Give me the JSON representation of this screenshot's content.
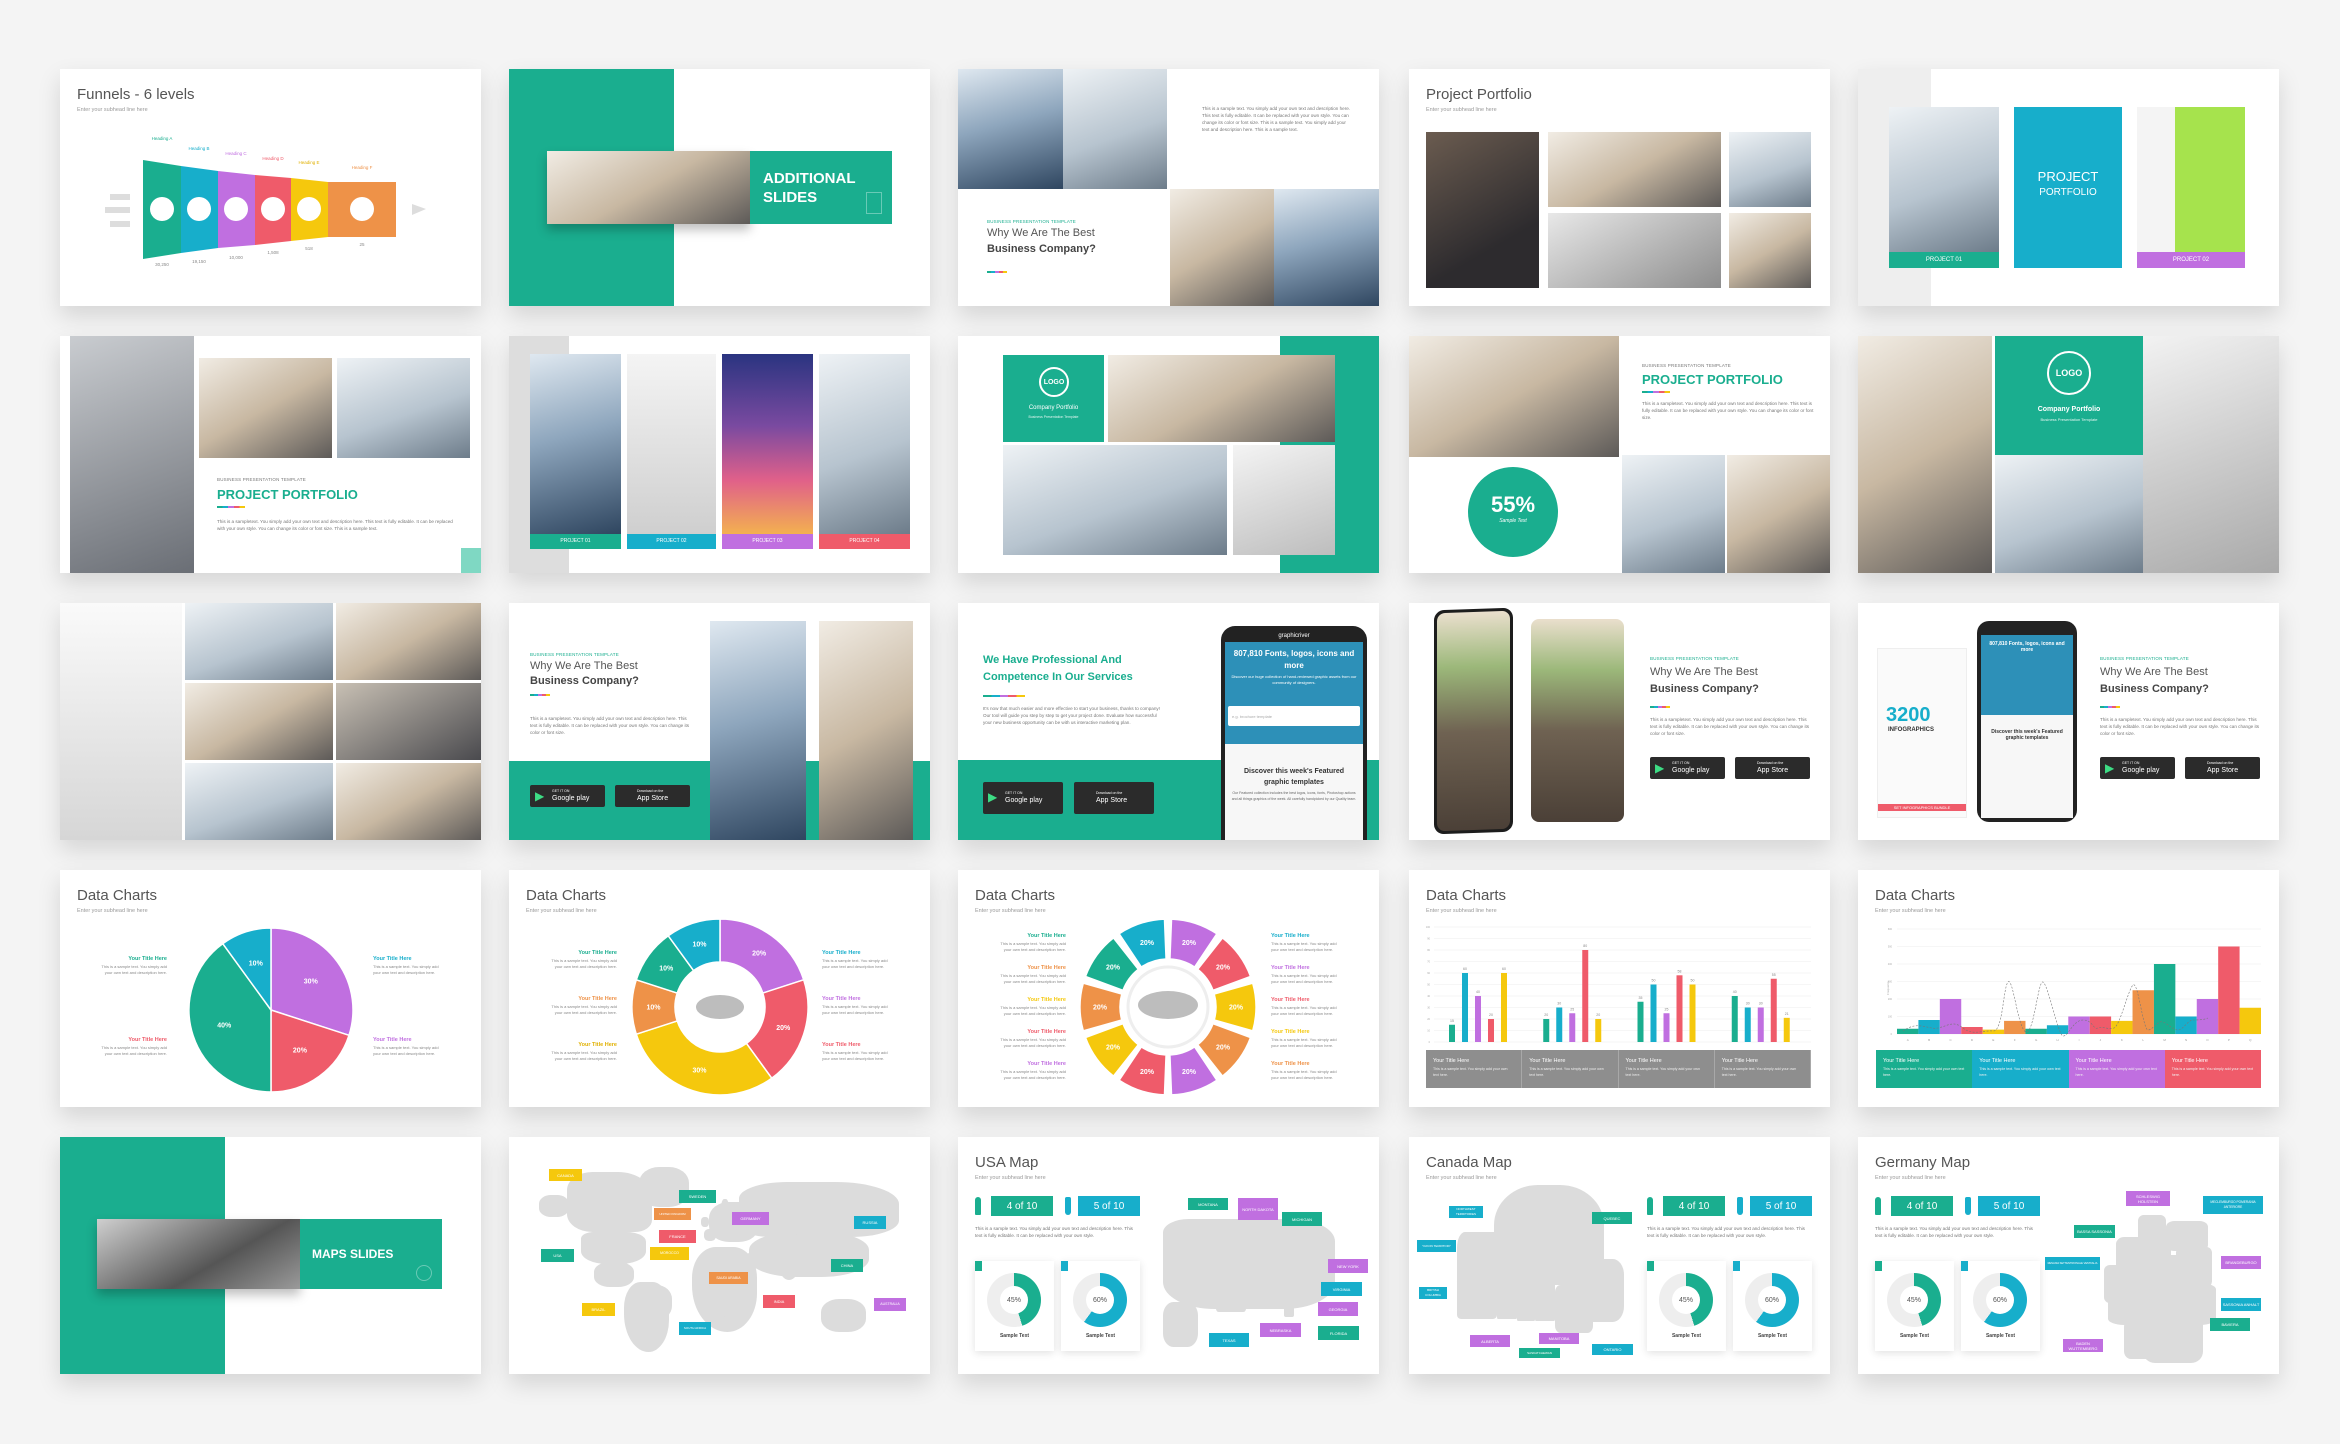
{
  "colors": {
    "green": "#1aae8f",
    "teal": "#17aecb",
    "purple": "#c06fe0",
    "red": "#ef5b6a",
    "yellow": "#f5c80d",
    "orange": "#ee9248",
    "gray": "#8e8e8e"
  },
  "common": {
    "subhead": "Enter your subhead line here",
    "your_title": "Your Title Here",
    "short_body": "This is a sample text. You simply add your own text and description here.",
    "bar_body": "This is a sample text. You simply add your own text here.",
    "template_label": "BUSINESS PRESENTATION TEMPLATE",
    "why_title_1": "Why We Are The Best",
    "why_title_2": "Business Company?",
    "why_body": "This is a sampletext. You simply add your own text and description here. This text is fully editable. It can be replaced with your own style. You can change its color or font size.",
    "portfolio_body": "This is a sampletext. You simply add your own text and description here. This text is fully editable. It can be replaced with your own style. You can change its color or font size. This is a sample text.",
    "map_body": "This is a sample text. You simply add your own text and description here. This text is fully editable. It can be replaced with your own style.",
    "sample_text": "Sample Text",
    "stat_male": "4 of 10",
    "stat_female": "5 of 10",
    "donut_labels": [
      "45%",
      "60%"
    ],
    "donut_values": [
      45,
      60
    ],
    "google_small": "GET IT ON",
    "google": "Google play",
    "apple_small": "Download on the",
    "apple": "App Store",
    "data_charts": "Data Charts"
  },
  "funnel": {
    "title": "Funnels - 6 levels",
    "headings": [
      "Heading A",
      "Heading B",
      "Heading C",
      "Heading D",
      "Heading E",
      "Heading F"
    ],
    "values": [
      "30,250",
      "19,150",
      "10,000",
      "1,508",
      "518",
      "25"
    ],
    "icons": [
      "search-icon",
      "chart-screen-icon",
      "monitor-icon",
      "bar-chart-icon",
      "handshake-icon",
      "target-icon"
    ]
  },
  "additional": {
    "line1": "ADDITIONAL",
    "line2": "SLIDES"
  },
  "why_intro": {
    "body": "This is a sample text. You simply add your own text and description here. This text is fully editable. It can be replaced with your own style. You can change its color or font size. This is a sample text. You simply add your text and description here. This is a sample text."
  },
  "portfolio_grid": {
    "title": "Project Portfolio"
  },
  "portfolio_cover": {
    "line1": "PROJECT",
    "line2": "PORTFOLIO",
    "project1": "PROJECT 01",
    "project2": "PROJECT 02"
  },
  "portfolio_text": {
    "title": "PROJECT PORTFOLIO"
  },
  "projects": [
    "PROJECT 01",
    "PROJECT 02",
    "PROJECT 03",
    "PROJECT 04"
  ],
  "logo": {
    "logo": "LOGO",
    "name": "Company Portfolio",
    "sub": "Business Presentation Template"
  },
  "percent": {
    "value": "55%",
    "caption": "Sample Text"
  },
  "services": {
    "title1": "We Have Professional And",
    "title2": "Competence In Our Services",
    "body": "It's now that much easier and more effective to start your business, thanks to company! Our tool will guide you step by step to get your project done. Evaluate how successful your new business opportunity can be with us interactive marketing plan."
  },
  "phone": {
    "brand": "graphicriver",
    "headline": "807,810 Fonts, logos, icons and more",
    "sub": "Discover our huge collection of hand-reviewed graphic assets from our community of designers.",
    "search_placeholder": "e.g. brochure template",
    "featured": "Discover this week's Featured graphic templates",
    "featured_body": "Our Featured collection includes the best logos, icons, fonts, Photoshop actions and all things graphics of the week. All carefully handpicked by our Quality team."
  },
  "infographic": {
    "number": "3200",
    "word": "INFOGRAPHICS",
    "banner": "SET INFOGRAPHICS BUNDLE"
  },
  "pie": {
    "values": [
      30,
      20,
      40,
      10
    ],
    "labels": [
      "30%",
      "20%",
      "40%",
      "10%"
    ],
    "colors": [
      "#c06fe0",
      "#ef5b6a",
      "#1aae8f",
      "#17aecb"
    ]
  },
  "donut": {
    "values": [
      20,
      20,
      30,
      10,
      10,
      10
    ],
    "labels": [
      "20%",
      "20%",
      "30%",
      "10%",
      "10%",
      "10%"
    ],
    "colors": [
      "#c06fe0",
      "#ef5b6a",
      "#f5c80d",
      "#ee9248",
      "#1aae8f",
      "#17aecb"
    ]
  },
  "ring": {
    "label": "20%",
    "colors": [
      "#c06fe0",
      "#ef5b6a",
      "#f5c80d",
      "#ee9248",
      "#c06fe0",
      "#ef5b6a",
      "#f5c80d",
      "#ee9248",
      "#1aae8f",
      "#17aecb"
    ],
    "left_title_colors": [
      "#1aae8f",
      "#ee9248",
      "#f5c80d",
      "#ef5b6a",
      "#c06fe0"
    ],
    "right_title_colors": [
      "#17aecb",
      "#c06fe0",
      "#ef5b6a",
      "#f5c80d",
      "#ee9248"
    ]
  },
  "chart_data": [
    {
      "type": "bar",
      "ylim": [
        0,
        100
      ],
      "yticks": [
        0,
        10,
        20,
        30,
        40,
        50,
        60,
        70,
        80,
        90,
        100
      ],
      "grid": true,
      "series_colors": [
        "#1aae8f",
        "#17aecb",
        "#c06fe0",
        "#ef5b6a",
        "#f5c80d"
      ],
      "groups": [
        [
          15,
          60,
          40,
          20,
          60
        ],
        [
          20,
          30,
          25,
          80,
          20
        ],
        [
          35,
          50,
          25,
          58,
          50
        ],
        [
          40,
          30,
          30,
          55,
          21
        ]
      ]
    },
    {
      "type": "bar",
      "ylabel": "Frequency",
      "ylim": [
        0,
        600
      ],
      "yticks": [
        0,
        100,
        200,
        300,
        400,
        500,
        600
      ],
      "grid": true,
      "categories": [
        "A",
        "B",
        "C",
        "D",
        "E",
        "F",
        "G",
        "H",
        "I",
        "J",
        "K",
        "L",
        "M",
        "N",
        "O",
        "P",
        "Q"
      ],
      "values": [
        30,
        80,
        200,
        40,
        25,
        75,
        30,
        50,
        100,
        100,
        75,
        250,
        400,
        100,
        200,
        500,
        150
      ]
    }
  ],
  "world_map": {
    "labels": [
      {
        "name": "CANADA",
        "c": "y"
      },
      {
        "name": "USA",
        "c": "g"
      },
      {
        "name": "SWEDEN",
        "c": "g"
      },
      {
        "name": "UNITED KINGDOM",
        "c": "o"
      },
      {
        "name": "GERMANY",
        "c": "p"
      },
      {
        "name": "FRANCE",
        "c": "r"
      },
      {
        "name": "MOROCCO",
        "c": "y"
      },
      {
        "name": "SAUDI ARABIA",
        "c": "o"
      },
      {
        "name": "INDIA",
        "c": "r"
      },
      {
        "name": "RUSSIA",
        "c": "b"
      },
      {
        "name": "CHINA",
        "c": "g"
      },
      {
        "name": "AUSTRALIA",
        "c": "p"
      },
      {
        "name": "BRAZIL",
        "c": "y"
      },
      {
        "name": "SOUTH AFRICA",
        "c": "b"
      }
    ]
  },
  "maps_slide": {
    "title": "MAPS SLIDES"
  },
  "usa": {
    "title": "USA Map",
    "states": [
      "MONTANA",
      "NORTH DAKOTA",
      "MICHIGAN",
      "NEW YORK",
      "VIRGINIA",
      "GEORGIA",
      "FLORIDA",
      "NEBRASKA",
      "TEXAS"
    ]
  },
  "canada": {
    "title": "Canada Map",
    "provinces": [
      "NORTHWEST TERRITORIES",
      "YUKON TERRITORY",
      "BRITISH COLUMBIA",
      "QUEBEC",
      "ALBERTA",
      "SASKATCHEWAN",
      "MANITOBA",
      "ONTARIO"
    ]
  },
  "germany": {
    "title": "Germany Map",
    "states": [
      "SCHLESWIG HOLSTEIN",
      "MECLEMBURGO POMERANIA ANTERIORE",
      "BASSA SASSONIA",
      "RENANIA SETTENTRIONALE VESTFALIA",
      "BRANDEBURGO",
      "SASSONIA ANHALT",
      "BAVIERA",
      "BADEN WUTTEMBERG"
    ]
  }
}
